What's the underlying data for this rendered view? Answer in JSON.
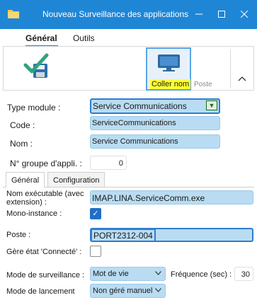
{
  "window": {
    "title": "Nouveau Surveillance des applications"
  },
  "ribbon": {
    "tabs": [
      "Général",
      "Outils"
    ],
    "coller_nom_label": "Coller nom",
    "poste_label": "Poste"
  },
  "form": {
    "type_module": {
      "label": "Type module :",
      "value": "Service Communications"
    },
    "code": {
      "label": "Code :",
      "value": "ServiceCommunications"
    },
    "nom": {
      "label": "Nom :",
      "value": "Service Communications"
    },
    "groupe": {
      "label": "N° groupe d'appli. :",
      "value": "0"
    }
  },
  "inner_tabs": [
    "Général",
    "Configuration"
  ],
  "general": {
    "executable": {
      "label": "Nom exécutable (avec extension) :",
      "value": "IMAP.LINA.ServiceComm.exe"
    },
    "mono_instance": {
      "label": "Mono-instance :",
      "checked": true
    },
    "poste": {
      "label": "Poste :",
      "value": "PORT2312-004"
    },
    "gere_etat": {
      "label": "Gère état 'Connecté' :",
      "checked": false
    },
    "mode_surveillance": {
      "label": "Mode de surveillance :",
      "value": "Mot de vie"
    },
    "frequence": {
      "label": "Fréquence (sec) :",
      "value": "30"
    },
    "mode_lancement": {
      "label": "Mode de lancement",
      "value": "Non géré manuel"
    }
  },
  "colors": {
    "titlebar": "#1f86d6",
    "field": "#b9dcf2",
    "highlight": "#ffff33",
    "checkbox": "#1f6fc8"
  }
}
